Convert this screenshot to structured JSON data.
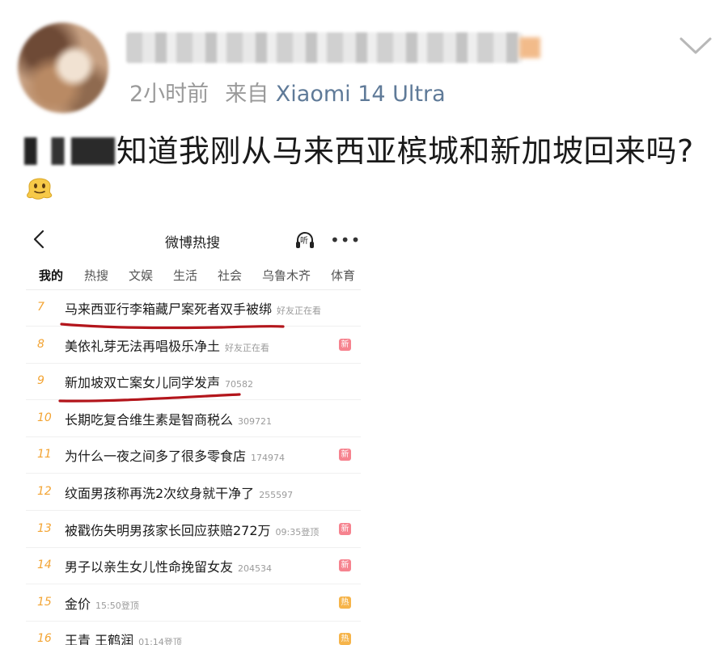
{
  "post": {
    "time": "2小时前",
    "source_prefix": "来自",
    "device": "Xiaomi 14 Ultra",
    "text": "知道我刚从马来西亚槟城和新加坡回来吗?",
    "emoji_icon": "melting-face-emoji-icon"
  },
  "screenshot": {
    "title": "微博热搜",
    "listen_label": "听",
    "more_label": "•••",
    "tabs": [
      "我的",
      "热搜",
      "文娱",
      "生活",
      "社会",
      "乌鲁木齐",
      "体育"
    ],
    "active_tab": "我的",
    "rows": [
      {
        "rank": "7",
        "text": "马来西亚行李箱藏尸案死者双手被绑",
        "extra": "好友正在看",
        "badge": "",
        "badge_color": ""
      },
      {
        "rank": "8",
        "text": "美依礼芽无法再唱极乐净土",
        "extra": "好友正在看",
        "badge": "新",
        "badge_color": "#f6838f"
      },
      {
        "rank": "9",
        "text": "新加坡双亡案女儿同学发声",
        "extra": "70582",
        "badge": "",
        "badge_color": ""
      },
      {
        "rank": "10",
        "text": "长期吃复合维生素是智商税么",
        "extra": "309721",
        "badge": "",
        "badge_color": ""
      },
      {
        "rank": "11",
        "text": "为什么一夜之间多了很多零食店",
        "extra": "174974",
        "badge": "新",
        "badge_color": "#f6838f"
      },
      {
        "rank": "12",
        "text": "纹面男孩称再洗2次纹身就干净了",
        "extra": "255597",
        "badge": "",
        "badge_color": ""
      },
      {
        "rank": "13",
        "text": "被戳伤失明男孩家长回应获赔272万",
        "extra": "09:35登顶",
        "badge": "新",
        "badge_color": "#f6838f"
      },
      {
        "rank": "14",
        "text": "男子以亲生女儿性命挽留女友",
        "extra": "204534",
        "badge": "新",
        "badge_color": "#f6838f"
      },
      {
        "rank": "15",
        "text": "金价",
        "extra": "15:50登顶",
        "badge": "热",
        "badge_color": "#f6b44a"
      },
      {
        "rank": "16",
        "text": "王青 王鹤润",
        "extra": "01:14登顶",
        "badge": "热",
        "badge_color": "#f6b44a"
      }
    ]
  },
  "colors": {
    "rank": "#f3a433",
    "device": "#5f7a98",
    "annotation": "#b3151b"
  }
}
